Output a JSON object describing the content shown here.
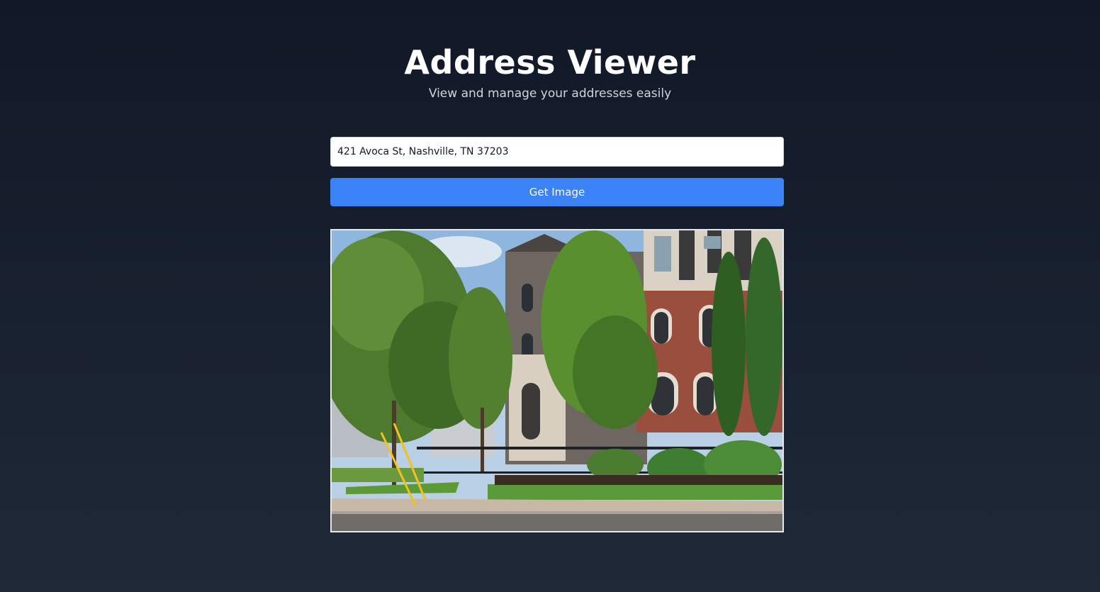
{
  "header": {
    "title": "Address Viewer",
    "subtitle": "View and manage your addresses easily"
  },
  "form": {
    "address_value": "421 Avoca St, Nashville, TN 37203",
    "button_label": "Get Image"
  },
  "result": {
    "image_kind": "street-view photo of brick townhouses with trees"
  },
  "colors": {
    "background_top": "#111827",
    "background_bottom": "#1f2937",
    "button": "#3b82f6",
    "subtitle": "#d1d5db"
  }
}
